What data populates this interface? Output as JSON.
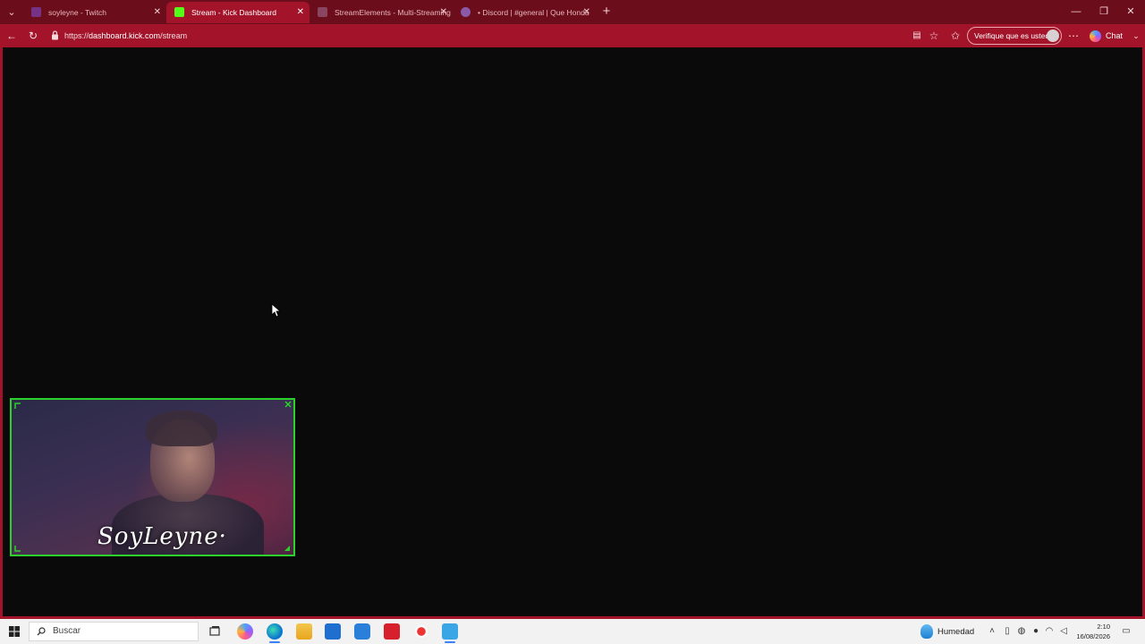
{
  "browser": {
    "tabs": [
      {
        "label": "soyleyne - Twitch",
        "active": false,
        "favicon": "twitch-icon",
        "color": "#9146ff"
      },
      {
        "label": "Stream - Kick Dashboard",
        "active": true,
        "favicon": "kick-icon",
        "color": "#53fc18"
      },
      {
        "label": "StreamElements - Multi-Streaming",
        "active": false,
        "favicon": "streamelements-icon",
        "color": "#7a5cff"
      },
      {
        "label": "• Discord | #general | Que Honda",
        "active": false,
        "favicon": "discord-icon",
        "color": "#5865f2"
      }
    ],
    "url_prefix": "https://",
    "url_host": "dashboard.kick.com",
    "url_path": "/stream",
    "verify_label": "Verifique que es usted",
    "chat_label": "Chat",
    "theme_color": "#a3142a",
    "tabstrip_color": "#6b0d1a"
  },
  "webcam": {
    "overlay_name": "SoyLeyne·",
    "border_color": "#2bd22b"
  },
  "taskbar": {
    "search_placeholder": "Buscar",
    "weather": "Humedad",
    "time": "2:10",
    "date": "16/08/2026"
  }
}
